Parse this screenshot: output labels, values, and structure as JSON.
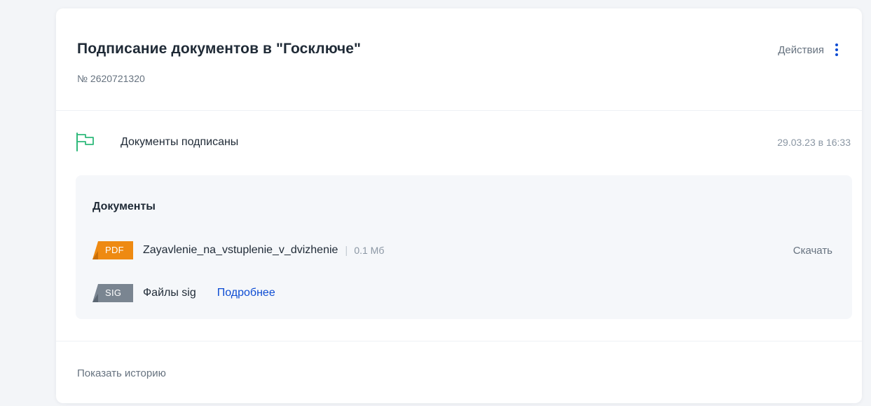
{
  "card": {
    "title": "Подписание документов в \"Госключе\"",
    "number": "№ 2620721320",
    "actions_label": "Действия",
    "icons": {
      "actions": "more-vertical-icon",
      "status": "flag-icon"
    },
    "colors": {
      "accent_blue": "#0d4cd3",
      "status_green": "#2fb97b",
      "pdf_orange": "#ee8a12",
      "sig_gray": "#66727f"
    }
  },
  "status": {
    "text": "Документы подписаны",
    "date": "29.03.23 в 16:33"
  },
  "documents": {
    "title": "Документы",
    "files": [
      {
        "type": "PDF",
        "name": "Zayavlenie_na_vstuplenie_v_dvizhenie",
        "separator": "|",
        "size": "0.1 Мб",
        "action": "Скачать"
      },
      {
        "type": "SIG",
        "name": "Файлы sig",
        "link": "Подробнее"
      }
    ]
  },
  "footer": {
    "history_label": "Показать историю"
  }
}
